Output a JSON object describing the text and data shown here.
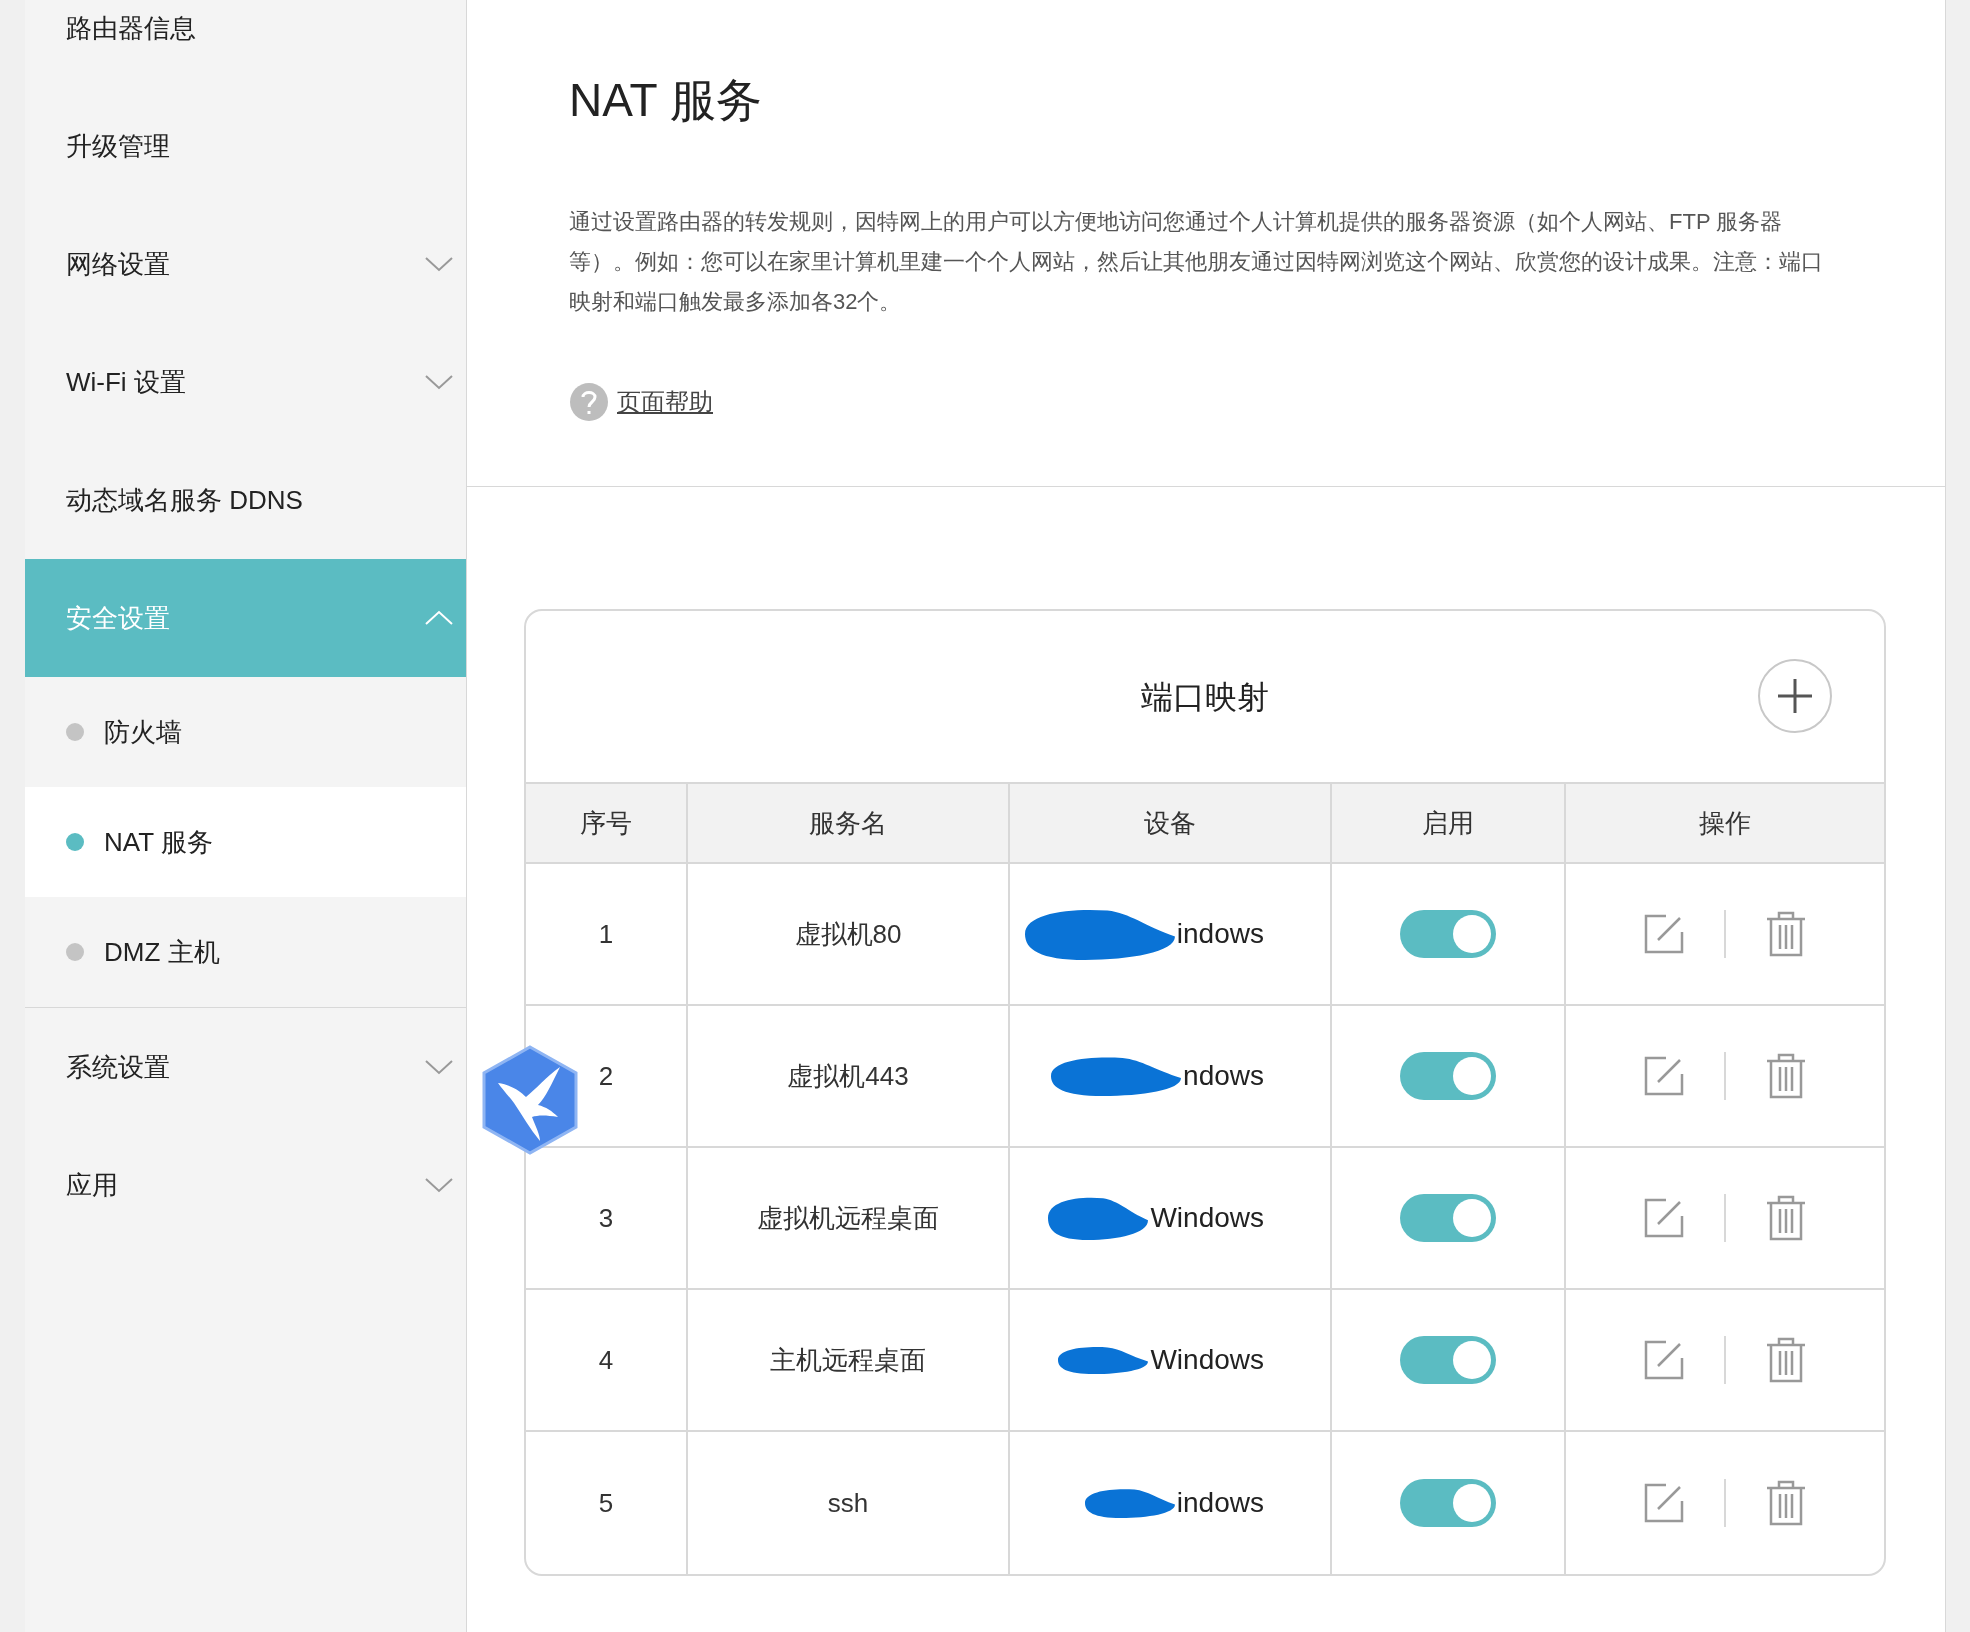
{
  "sidebar": {
    "items": [
      {
        "label": "路由器信息",
        "kind": "item",
        "selected": false
      },
      {
        "label": "升级管理",
        "kind": "item",
        "selected": false
      },
      {
        "label": "网络设置",
        "kind": "group",
        "expanded": false,
        "selected": false
      },
      {
        "label": "Wi-Fi 设置",
        "kind": "group",
        "expanded": false,
        "selected": false
      },
      {
        "label": "动态域名服务 DDNS",
        "kind": "item",
        "selected": false
      },
      {
        "label": "安全设置",
        "kind": "group",
        "expanded": true,
        "selected": true,
        "children": [
          {
            "label": "防火墙",
            "selected": false
          },
          {
            "label": "NAT 服务",
            "selected": true
          },
          {
            "label": "DMZ 主机",
            "selected": false
          }
        ]
      },
      {
        "label": "系统设置",
        "kind": "group",
        "expanded": false,
        "selected": false
      },
      {
        "label": "应用",
        "kind": "group",
        "expanded": false,
        "selected": false
      }
    ]
  },
  "page": {
    "title": "NAT 服务",
    "description": "通过设置路由器的转发规则，因特网上的用户可以方便地访问您通过个人计算机提供的服务器资源（如个人网站、FTP 服务器等）。例如：您可以在家里计算机里建一个个人网站，然后让其他朋友通过因特网浏览这个网站、欣赏您的设计成果。注意：端口映射和端口触发最多添加各32个。",
    "help_link": "页面帮助"
  },
  "table": {
    "title": "端口映射",
    "columns": [
      "序号",
      "服务名",
      "设备",
      "启用",
      "操作"
    ],
    "rows": [
      {
        "index": "1",
        "service": "虚拟机80",
        "device": "indows",
        "enabled": true
      },
      {
        "index": "2",
        "service": "虚拟机443",
        "device": "ndows",
        "enabled": true
      },
      {
        "index": "3",
        "service": "虚拟机远程桌面",
        "device": "Windows",
        "enabled": true
      },
      {
        "index": "4",
        "service": "主机远程桌面",
        "device": "Windows",
        "enabled": true
      },
      {
        "index": "5",
        "service": "ssh",
        "device": "indows",
        "enabled": true
      }
    ]
  }
}
